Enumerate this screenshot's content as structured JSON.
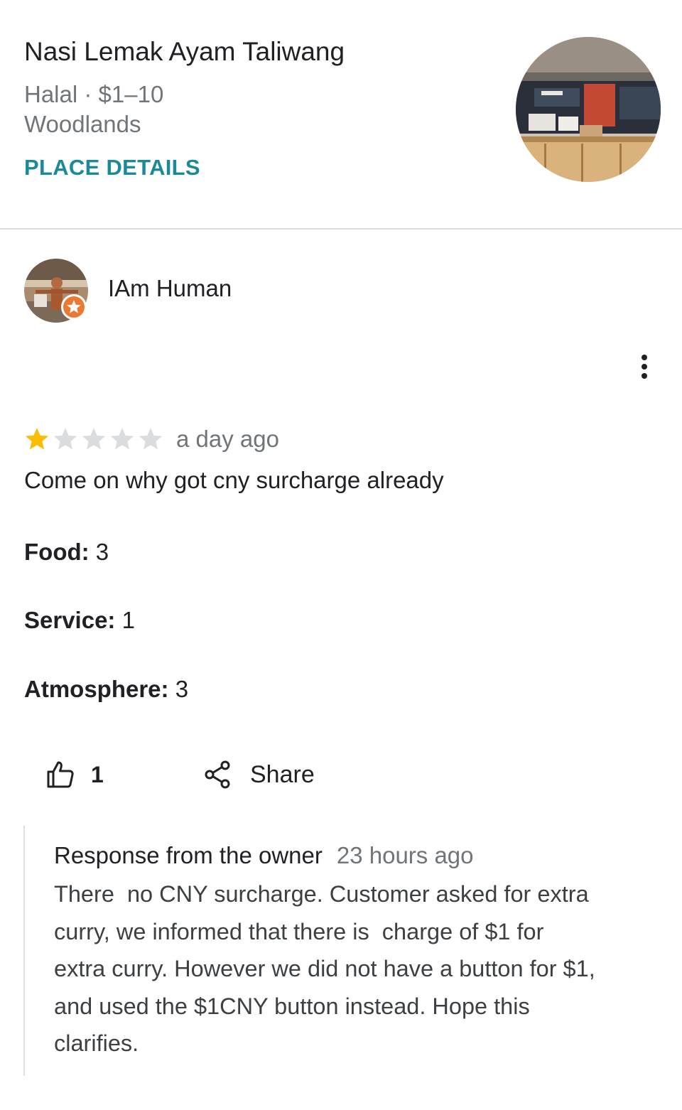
{
  "place": {
    "name": "Nasi Lemak Ayam Taliwang",
    "meta": "Halal · $1–10",
    "area": "Woodlands",
    "details_label": "PLACE DETAILS"
  },
  "review": {
    "author": "IAm Human",
    "rating": 1,
    "max_rating": 5,
    "time": "a day ago",
    "text": "Come on why got cny surcharge already",
    "aspects": [
      {
        "label": "Food:",
        "value": "3"
      },
      {
        "label": "Service:",
        "value": "1"
      },
      {
        "label": "Atmosphere:",
        "value": "3"
      }
    ],
    "likes": "1",
    "share_label": "Share"
  },
  "owner_response": {
    "heading": "Response from the owner",
    "time": "23 hours ago",
    "text": "There  no CNY surcharge. Customer asked for extra\ncurry, we informed that there is  charge of $1 for\nextra curry. However we did not have a button for $1,\nand used the $1CNY button instead. Hope this\nclarifies."
  },
  "colors": {
    "accent": "#1a8a9a",
    "star_filled": "#fbbc04",
    "star_empty": "#dadce0",
    "secondary_text": "#70757a",
    "local_guide_badge": "#ea7a32"
  },
  "icons": {
    "more": "more-vertical-icon",
    "like": "thumbs-up-icon",
    "share": "share-icon",
    "badge": "local-guide-star-icon"
  }
}
